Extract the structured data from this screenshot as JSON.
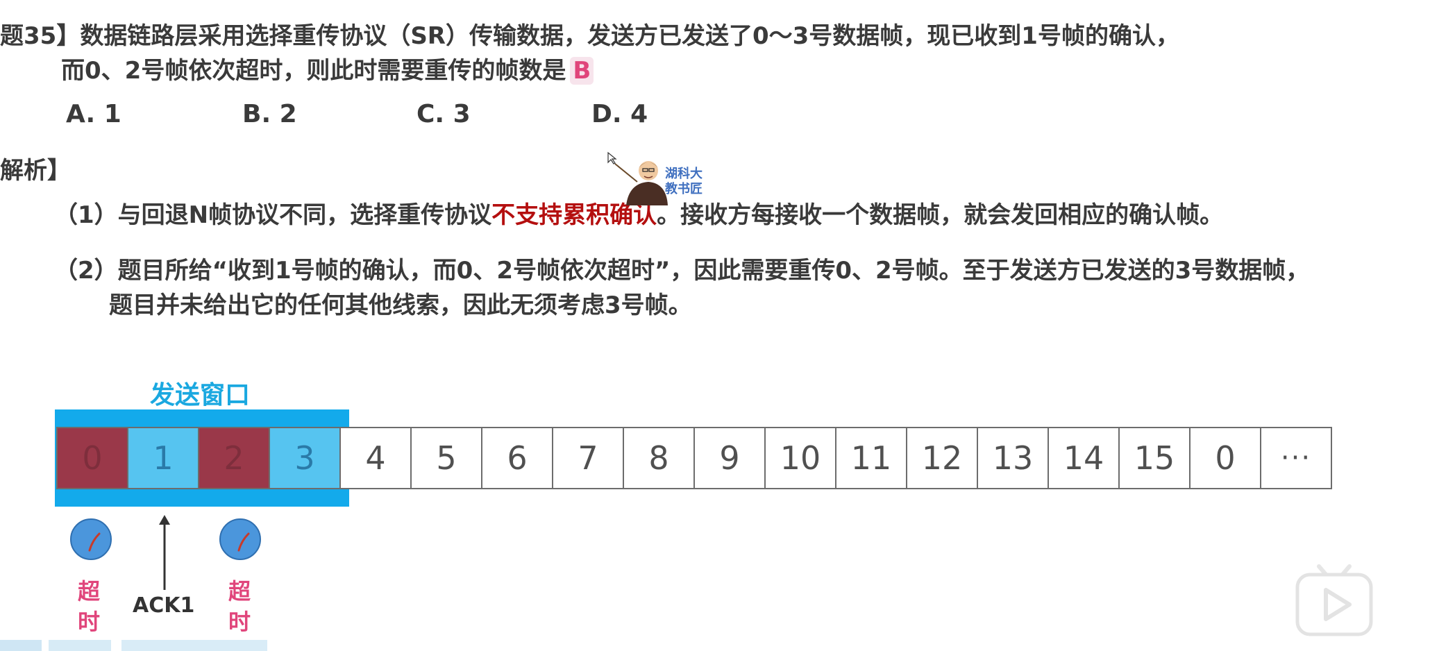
{
  "question": {
    "line1": "题35】数据链路层采用选择重传协议（SR）传输数据，发送方已发送了0～3号数据帧，现已收到1号帧的确认，",
    "line2": "而0、2号帧依次超时，则此时需要重传的帧数是",
    "answer": "B",
    "options": [
      "A. 1",
      "B. 2",
      "C. 3",
      "D. 4"
    ]
  },
  "analysis": {
    "heading": "解析】",
    "p1_prefix": "（1）与回退N帧协议不同，选择重传协议",
    "p1_highlight": "不支持累积确认",
    "p1_suffix": "。接收方每接收一个数据帧，就会发回相应的确认帧。",
    "p2_line1": "（2）题目所给“收到1号帧的确认，而0、2号帧依次超时”，因此需要重传0、2号帧。至于发送方已发送的3号数据帧，",
    "p2_line2": "题目并未给出它的任何其他线索，因此无须考虑3号帧。"
  },
  "watermark": {
    "brand_line1": "湖科大",
    "brand_line2": "教书匠"
  },
  "diagram": {
    "window_label": "发送窗口",
    "frames": [
      {
        "label": "0",
        "state": "red"
      },
      {
        "label": "1",
        "state": "blue"
      },
      {
        "label": "2",
        "state": "red"
      },
      {
        "label": "3",
        "state": "blue"
      },
      {
        "label": "4",
        "state": "plain"
      },
      {
        "label": "5",
        "state": "plain"
      },
      {
        "label": "6",
        "state": "plain"
      },
      {
        "label": "7",
        "state": "plain"
      },
      {
        "label": "8",
        "state": "plain"
      },
      {
        "label": "9",
        "state": "plain"
      },
      {
        "label": "10",
        "state": "plain"
      },
      {
        "label": "11",
        "state": "plain"
      },
      {
        "label": "12",
        "state": "plain"
      },
      {
        "label": "13",
        "state": "plain"
      },
      {
        "label": "14",
        "state": "plain"
      },
      {
        "label": "15",
        "state": "plain"
      },
      {
        "label": "0",
        "state": "plain"
      },
      {
        "label": "···",
        "state": "dots"
      }
    ],
    "timeout_label": "超时",
    "timeout_char1": "超",
    "timeout_char2": "时",
    "ack_label": "ACK1"
  },
  "colors": {
    "timeout_frame": "#9a3849",
    "acked_frame": "#56c4f0",
    "window_frame": "#13aaeb",
    "highlight_text": "#b40f0f",
    "timeout_text": "#e0457b"
  }
}
